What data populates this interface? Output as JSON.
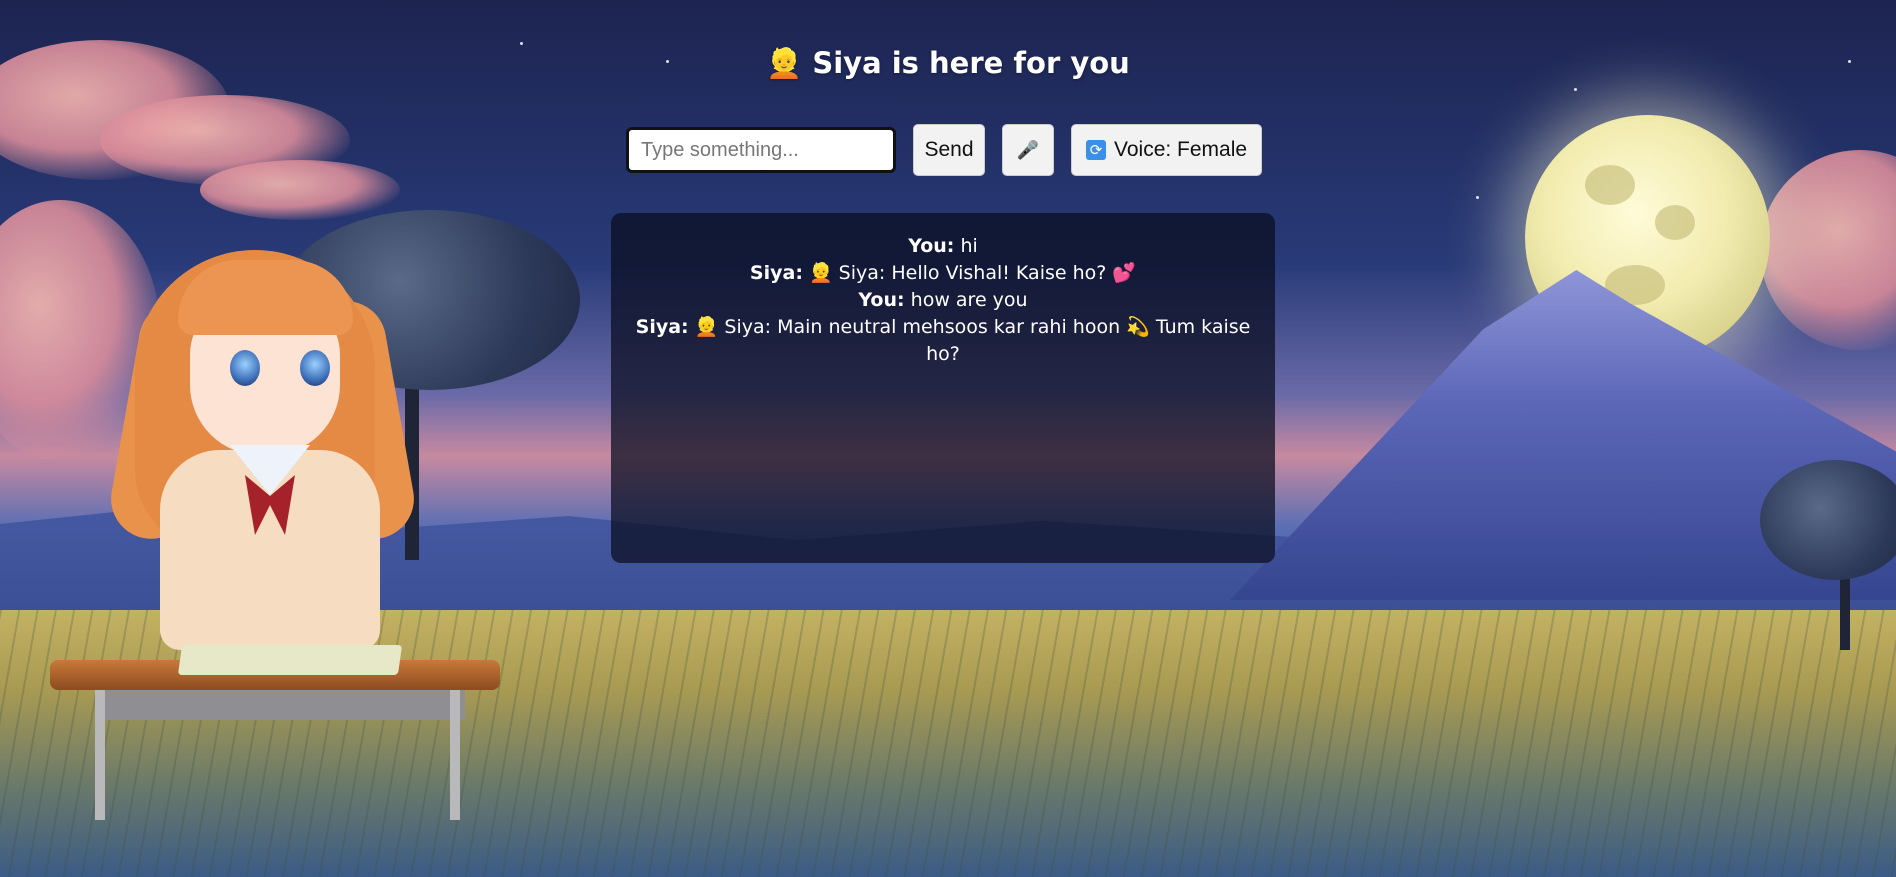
{
  "header": {
    "title": "👱 Siya is here for you"
  },
  "controls": {
    "input_placeholder": "Type something...",
    "input_value": "",
    "send_label": "Send",
    "mic_icon": "🎤",
    "voice_icon": "🔄",
    "voice_label": "Voice: Female"
  },
  "chat": {
    "messages": [
      {
        "sender": "You:",
        "text": "hi"
      },
      {
        "sender": "Siya:",
        "text": "👱 Siya: Hello Vishal! Kaise ho? 💕"
      },
      {
        "sender": "You:",
        "text": "how are you"
      },
      {
        "sender": "Siya:",
        "text": "👱 Siya: Main neutral mehsoos kar rahi hoon 💫 Tum kaise ho?"
      }
    ]
  }
}
